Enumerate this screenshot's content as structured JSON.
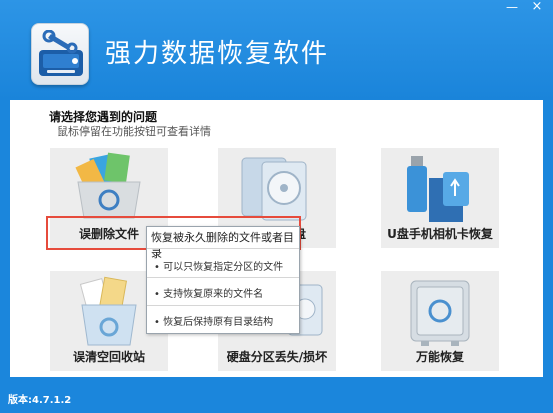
{
  "window": {
    "title": "强力数据恢复软件",
    "minimize_glyph": "—",
    "close_glyph": "×",
    "logo_icon": "hard-drive-wrench-icon"
  },
  "prompt": {
    "title": "请选择您遇到的问题",
    "subtitle": "鼠标停留在功能按钮可查看详情"
  },
  "tiles": [
    {
      "label": "误删除文件",
      "icon": "documents-recycle-icon"
    },
    {
      "label": "盘",
      "icon": "hard-disk-format-icon"
    },
    {
      "label": "U盘手机相机卡恢复",
      "icon": "usb-sdcard-icon"
    },
    {
      "label": "误清空回收站",
      "icon": "recycle-bin-icon"
    },
    {
      "label": "硬盘分区丢失/损坏",
      "icon": "disk-partition-icon"
    },
    {
      "label": "万能恢复",
      "icon": "safe-box-icon"
    }
  ],
  "tooltip": {
    "head": "恢复被永久删除的文件或者目录",
    "items": [
      "• 可以只恢复指定分区的文件",
      "• 支持恢复原来的文件名",
      "• 恢复后保持原有目录结构"
    ]
  },
  "footer": {
    "version": "版本:4.7.1.2"
  },
  "colors": {
    "header_blue": "#1b86dc",
    "highlight_red": "#e64b3c",
    "tile_bg": "#ededed"
  }
}
